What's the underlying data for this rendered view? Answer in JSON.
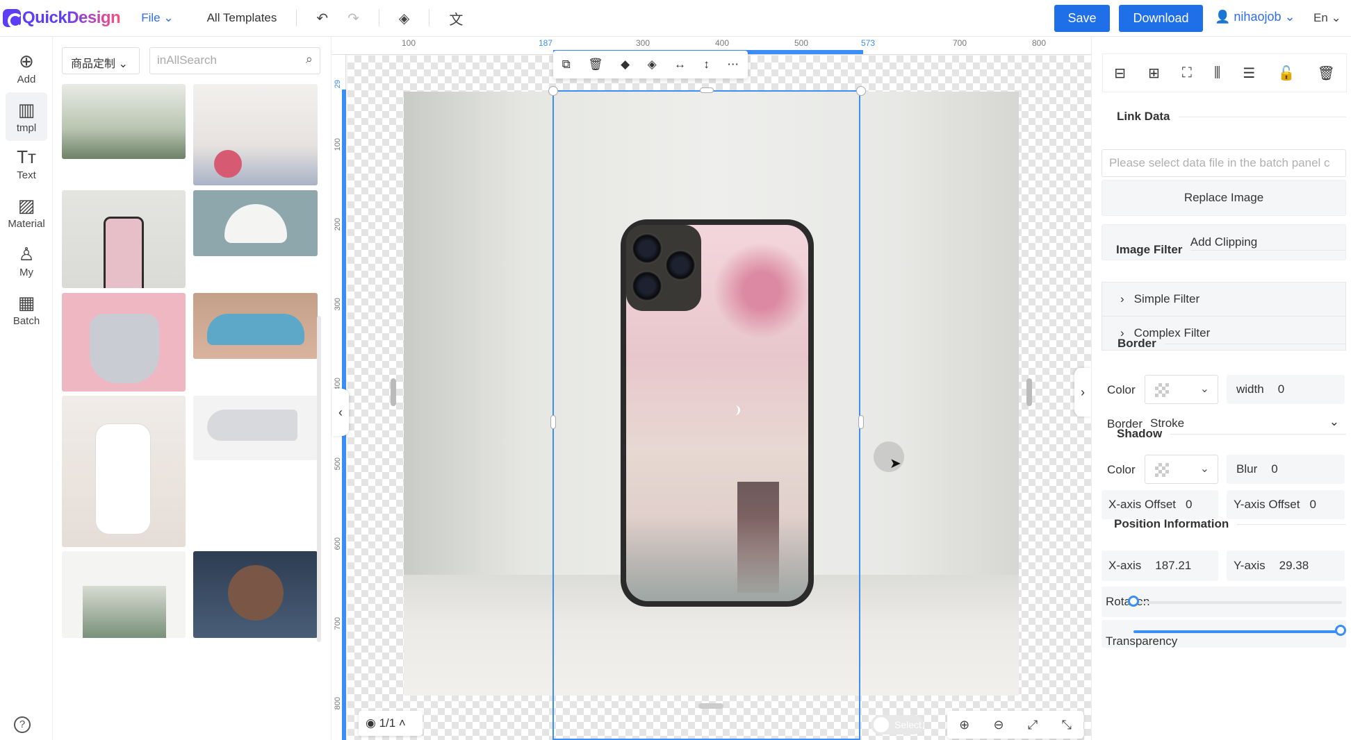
{
  "topbar": {
    "logo_a": "Quick",
    "logo_b": "Design",
    "file": "File ⌄",
    "templates": "All Templates",
    "save": "Save",
    "download": "Download",
    "user": "nihaojob ⌄",
    "lang": "En ⌄"
  },
  "nav": [
    {
      "label": "Add",
      "icon": "⊕"
    },
    {
      "label": "tmpl",
      "icon": "▥"
    },
    {
      "label": "Text",
      "icon": "Tт"
    },
    {
      "label": "Material",
      "icon": "▨"
    },
    {
      "label": "My",
      "icon": "♙"
    },
    {
      "label": "Batch",
      "icon": "▦"
    }
  ],
  "help": "?",
  "panel": {
    "category": "商品定制 ⌄",
    "search_placeholder": "inAllSearch"
  },
  "ruler": {
    "top": [
      "100",
      "187",
      "300",
      "400",
      "500",
      "573",
      "700",
      "800"
    ],
    "left": [
      "29",
      "100",
      "200",
      "300",
      "400",
      "500",
      "600",
      "700",
      "800"
    ]
  },
  "floatbar_icons": [
    "copy-icon",
    "trash-icon",
    "layer-up-icon",
    "layer-top-icon",
    "flip-h-icon",
    "flip-v-icon",
    "more-icon"
  ],
  "page_indicator": "1/1",
  "toggle_label": "Select",
  "right": {
    "link_data": "Link Data",
    "link_placeholder": "Please select data file in the batch panel c",
    "replace_image": "Replace Image",
    "add_clipping": "Add Clipping",
    "image_filter": "Image Filter",
    "simple_filter": "Simple Filter",
    "complex_filter": "Complex Filter",
    "border": "Border",
    "color": "Color",
    "width_label": "width",
    "width_value": "0",
    "border_label": "Border",
    "border_value": "Stroke",
    "shadow": "Shadow",
    "blur_label": "Blur",
    "blur_value": "0",
    "x_offset_label": "X-axis Offset",
    "x_offset_value": "0",
    "y_offset_label": "Y-axis Offset",
    "y_offset_value": "0",
    "position": "Position Information",
    "x_label": "X-axis",
    "x_value": "187.21",
    "y_label": "Y-axis",
    "y_value": "29.38",
    "rotation": "Rotation",
    "transparency": "Transparency"
  }
}
